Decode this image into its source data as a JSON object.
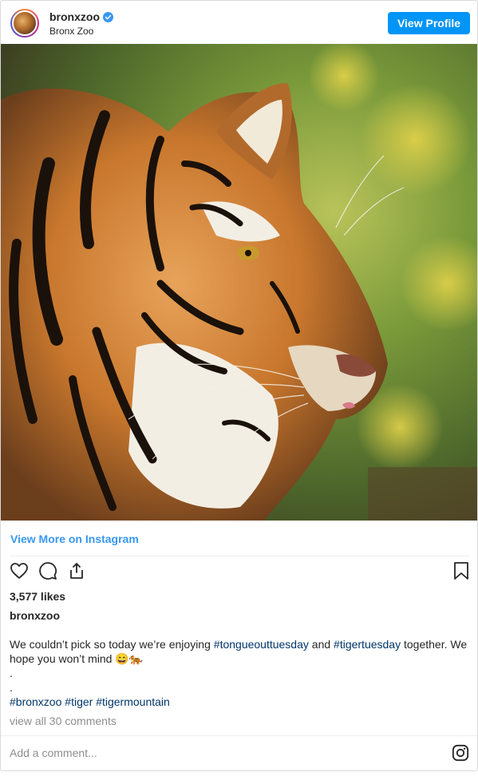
{
  "header": {
    "username": "bronxzoo",
    "display_name": "Bronx Zoo",
    "verified": true,
    "view_profile_label": "View Profile"
  },
  "post": {
    "image_alt": "tiger",
    "view_more_label": "View More on Instagram",
    "likes": "3,577 likes",
    "caption_user": "bronxzoo",
    "caption_text_1": "We couldn’t pick so today we’re enjoying ",
    "caption_tag_1": "#tongueouttuesday",
    "caption_text_2": " and ",
    "caption_tag_2": "#tigertuesday",
    "caption_text_3": " together. We hope you won’t mind 😄🐅",
    "dot_1": ".",
    "dot_2": ".",
    "tags": [
      "#bronxzoo",
      "#tiger",
      "#tigermountain"
    ],
    "view_comments_label": "view all 30 comments",
    "add_comment_placeholder": "Add a comment..."
  },
  "icons": {
    "like": "heart-icon",
    "comment": "comment-icon",
    "share": "share-icon",
    "save": "bookmark-icon",
    "brand": "instagram-icon"
  },
  "colors": {
    "accent": "#0095f6",
    "link": "#3897f0",
    "hashtag": "#003569",
    "muted": "#8e8e8e",
    "verified": "#3897f0"
  }
}
